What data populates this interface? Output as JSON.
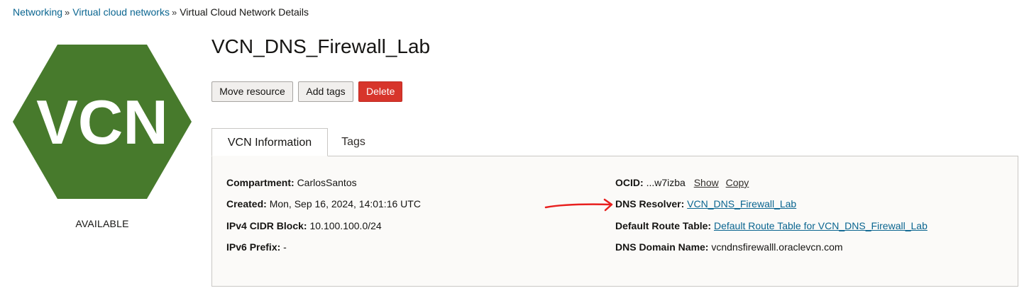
{
  "breadcrumb": {
    "items": [
      "Networking",
      "Virtual cloud networks",
      "Virtual Cloud Network Details"
    ],
    "separator": "»"
  },
  "resource_icon": {
    "text": "VCN",
    "color": "#477a2c",
    "icon": "vcn-hexagon-icon"
  },
  "status": "AVAILABLE",
  "title": "VCN_DNS_Firewall_Lab",
  "actions": {
    "move": "Move resource",
    "add_tags": "Add tags",
    "delete": "Delete"
  },
  "tabs": {
    "info": "VCN Information",
    "tags": "Tags"
  },
  "info": {
    "compartment": {
      "label": "Compartment:",
      "value": "CarlosSantos"
    },
    "created": {
      "label": "Created:",
      "value": "Mon, Sep 16, 2024, 14:01:16 UTC"
    },
    "ipv4": {
      "label": "IPv4 CIDR Block:",
      "value": "10.100.100.0/24"
    },
    "ipv6": {
      "label": "IPv6 Prefix:",
      "value": "-"
    },
    "ocid": {
      "label": "OCID:",
      "value": "...w7izba",
      "show": "Show",
      "copy": "Copy"
    },
    "dns_resolver": {
      "label": "DNS Resolver:",
      "value": "VCN_DNS_Firewall_Lab"
    },
    "route_table": {
      "label": "Default Route Table:",
      "value": "Default Route Table for VCN_DNS_Firewall_Lab"
    },
    "dns_domain": {
      "label": "DNS Domain Name:",
      "value": "vcndnsfirewalll.oraclevcn.com"
    }
  },
  "colors": {
    "link": "#0a6590",
    "danger": "#d7352b",
    "annotation": "#e8201f"
  }
}
